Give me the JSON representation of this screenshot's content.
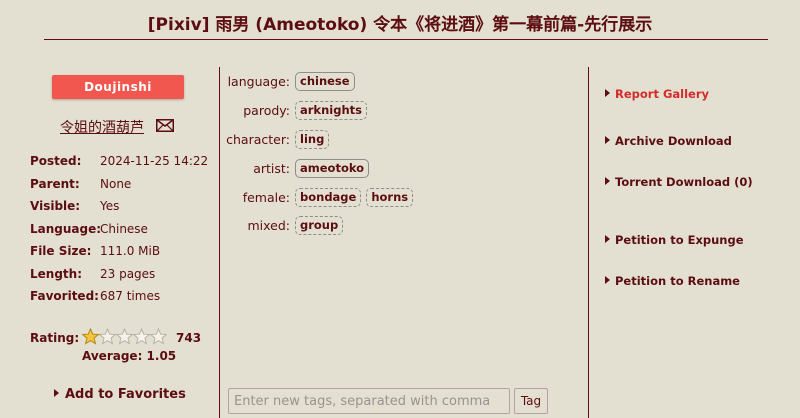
{
  "gallery": {
    "title": "[Pixiv] 雨男 (Ameotoko) 令本《将进酒》第一幕前篇-先行展示",
    "category": "Doujinshi",
    "uploader": "令姐的酒葫芦"
  },
  "info": [
    {
      "label": "Posted:",
      "value": "2024-11-25 14:22"
    },
    {
      "label": "Parent:",
      "value": "None"
    },
    {
      "label": "Visible:",
      "value": "Yes"
    },
    {
      "label": "Language:",
      "value": "Chinese"
    },
    {
      "label": "File Size:",
      "value": "111.0 MiB"
    },
    {
      "label": "Length:",
      "value": "23 pages"
    },
    {
      "label": "Favorited:",
      "value": "687 times"
    }
  ],
  "rating": {
    "label": "Rating:",
    "count": "743",
    "average": "Average: 1.05",
    "value": 1.05,
    "max": 5
  },
  "favorites": {
    "label": "Add to Favorites"
  },
  "tags": [
    {
      "namespace": "language:",
      "items": [
        {
          "text": "chinese",
          "style": "solid"
        }
      ]
    },
    {
      "namespace": "parody:",
      "items": [
        {
          "text": "arknights",
          "style": "dashed"
        }
      ]
    },
    {
      "namespace": "character:",
      "items": [
        {
          "text": "ling",
          "style": "dashed"
        }
      ]
    },
    {
      "namespace": "artist:",
      "items": [
        {
          "text": "ameotoko",
          "style": "solid"
        }
      ]
    },
    {
      "namespace": "female:",
      "items": [
        {
          "text": "bondage",
          "style": "dashed"
        },
        {
          "text": "horns",
          "style": "dashed"
        }
      ]
    },
    {
      "namespace": "mixed:",
      "items": [
        {
          "text": "group",
          "style": "dashed"
        }
      ]
    }
  ],
  "tag_input": {
    "placeholder": "Enter new tags, separated with comma",
    "value": "",
    "button": "Tag"
  },
  "actions": [
    {
      "label": "Report Gallery",
      "highlight": true
    },
    {
      "label": "Archive Download",
      "highlight": false
    },
    {
      "label": "Torrent Download (0)",
      "highlight": false
    },
    {
      "label": "Petition to Expunge",
      "highlight": false
    },
    {
      "label": "Petition to Rename",
      "highlight": false
    }
  ],
  "colors": {
    "background": "#e3e0d1",
    "text": "#5c0d11",
    "category_badge": "#f2574f",
    "report_link": "#d42b2b",
    "star_fill": "#f5c542"
  },
  "icons": {
    "uploader_contact": "mail-icon",
    "rating_star": "star-icon",
    "action_bullet": "triangle-right-icon"
  }
}
